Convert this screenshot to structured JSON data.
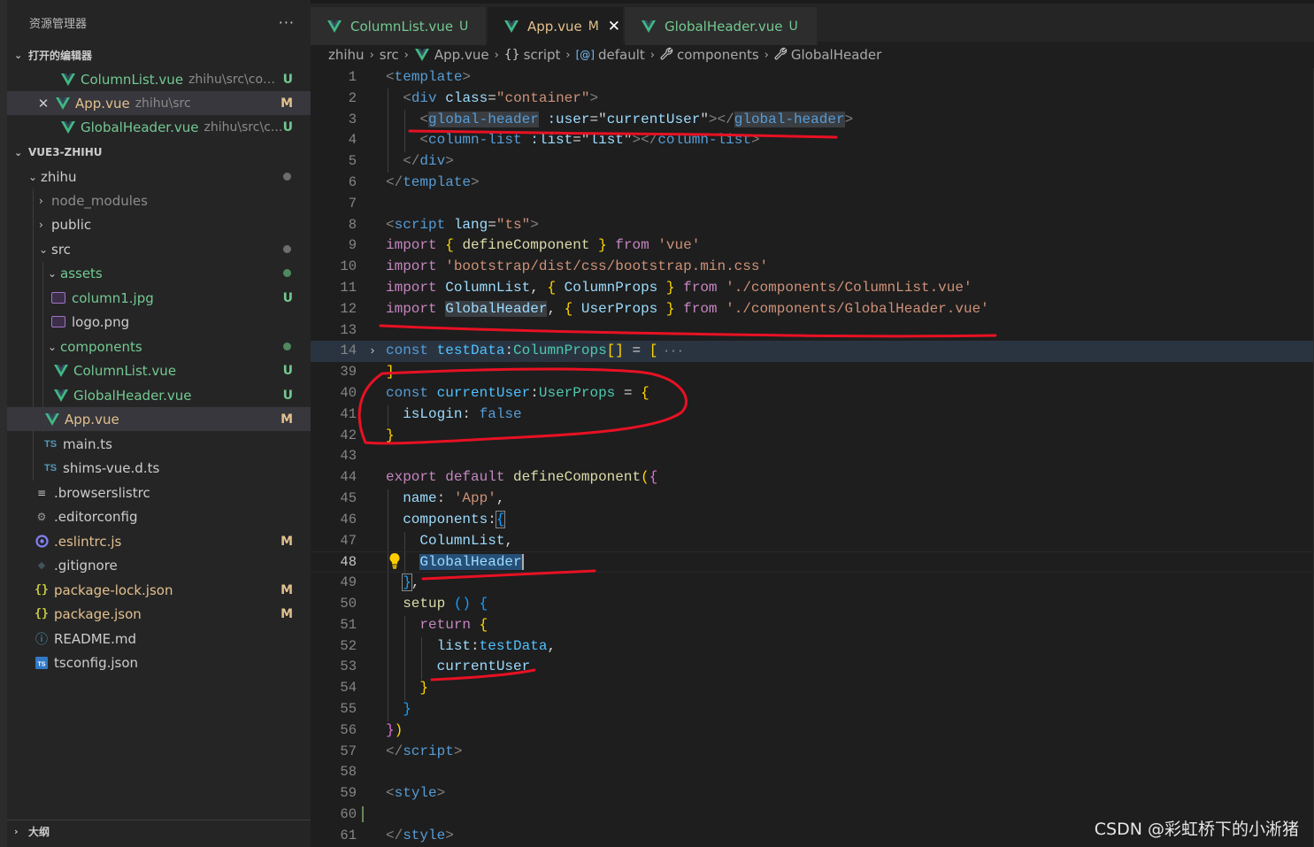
{
  "sidebar": {
    "title": "资源管理器",
    "more_label": "···",
    "open_editors": {
      "label": "打开的编辑器",
      "items": [
        {
          "name": "ColumnList.vue",
          "path": "zhihu\\src\\com...",
          "status": "U"
        },
        {
          "name": "App.vue",
          "path": "zhihu\\src",
          "status": "M"
        },
        {
          "name": "GlobalHeader.vue",
          "path": "zhihu\\src\\c...",
          "status": "U"
        }
      ],
      "close_glyph": "✕"
    },
    "project": {
      "label": "VUE3-ZHIHU",
      "tree": [
        {
          "name": "zhihu"
        },
        {
          "name": "node_modules"
        },
        {
          "name": "public"
        },
        {
          "name": "src"
        },
        {
          "name": "assets"
        },
        {
          "name": "column1.jpg",
          "status": "U"
        },
        {
          "name": "logo.png"
        },
        {
          "name": "components"
        },
        {
          "name": "ColumnList.vue",
          "status": "U"
        },
        {
          "name": "GlobalHeader.vue",
          "status": "U"
        },
        {
          "name": "App.vue",
          "status": "M"
        },
        {
          "name": "main.ts"
        },
        {
          "name": "shims-vue.d.ts"
        },
        {
          "name": ".browserslistrc"
        },
        {
          "name": ".editorconfig"
        },
        {
          "name": ".eslintrc.js",
          "status": "M"
        },
        {
          "name": ".gitignore"
        },
        {
          "name": "package-lock.json",
          "status": "M"
        },
        {
          "name": "package.json",
          "status": "M"
        },
        {
          "name": "README.md"
        },
        {
          "name": "tsconfig.json"
        }
      ]
    },
    "outline_label": "大纲",
    "icons": {
      "ts": "TS",
      "json": "{}",
      "info": "ⓘ",
      "lines": "≡",
      "gear": "⚙",
      "diamond": "◆"
    }
  },
  "tabs": [
    {
      "name": "ColumnList.vue",
      "status": "U",
      "active": false
    },
    {
      "name": "App.vue",
      "status": "M",
      "active": true,
      "close": "✕"
    },
    {
      "name": "GlobalHeader.vue",
      "status": "U",
      "active": false
    }
  ],
  "breadcrumb": [
    "zhihu",
    "src",
    "App.vue",
    "script",
    "default",
    "components",
    "GlobalHeader"
  ],
  "breadcrumb_icons": {
    "script": "{}",
    "default": "[@]",
    "components": "🔧"
  },
  "editor": {
    "current_line": 48,
    "line_numbers": [
      1,
      2,
      3,
      4,
      5,
      6,
      7,
      8,
      9,
      10,
      11,
      12,
      13,
      14,
      39,
      40,
      41,
      42,
      43,
      44,
      45,
      46,
      47,
      48,
      49,
      50,
      51,
      52,
      53,
      54,
      55,
      56,
      57,
      58,
      59,
      60,
      61
    ],
    "folded_ellipsis": "···"
  },
  "colors": {
    "annotation": "#e81123",
    "status_untracked": "#73c991",
    "status_modified": "#e2c08d",
    "vue_green": "#41b883"
  },
  "watermark": "CSDN @彩虹桥下的小淅猪"
}
